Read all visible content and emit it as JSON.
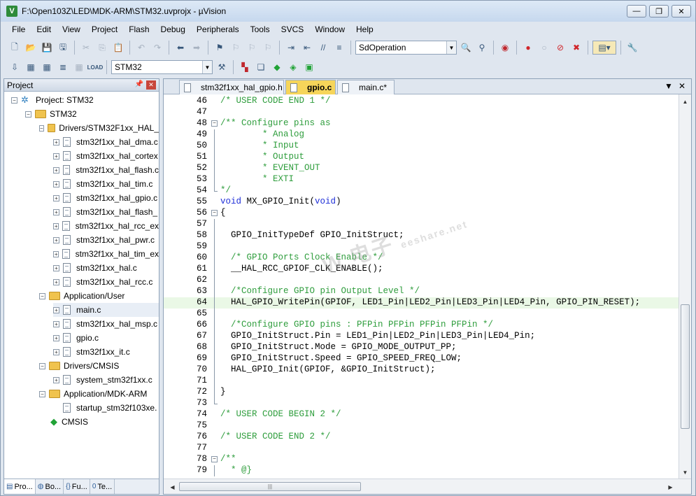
{
  "window": {
    "title": "F:\\Open103Z\\LED\\MDK-ARM\\STM32.uvprojx - µVision",
    "app_icon_label": "V",
    "controls": [
      "—",
      "❐",
      "✕"
    ]
  },
  "menu": [
    "File",
    "Edit",
    "View",
    "Project",
    "Flash",
    "Debug",
    "Peripherals",
    "Tools",
    "SVCS",
    "Window",
    "Help"
  ],
  "toolbar": {
    "find_combo_value": "SdOperation",
    "target_combo_value": "STM32"
  },
  "project_pane": {
    "title": "Project",
    "pin_icon": "pin-icon",
    "root": "Project: STM32",
    "target": "STM32",
    "tree": [
      {
        "label": "Drivers/STM32F1xx_HAL_",
        "kind": "folder",
        "level": 2
      },
      {
        "label": "stm32f1xx_hal_dma.c",
        "kind": "file",
        "level": 3
      },
      {
        "label": "stm32f1xx_hal_cortex",
        "kind": "file",
        "level": 3
      },
      {
        "label": "stm32f1xx_hal_flash.c",
        "kind": "file",
        "level": 3
      },
      {
        "label": "stm32f1xx_hal_tim.c",
        "kind": "file",
        "level": 3
      },
      {
        "label": "stm32f1xx_hal_gpio.c",
        "kind": "file",
        "level": 3
      },
      {
        "label": "stm32f1xx_hal_flash_",
        "kind": "file",
        "level": 3
      },
      {
        "label": "stm32f1xx_hal_rcc_ex",
        "kind": "file",
        "level": 3
      },
      {
        "label": "stm32f1xx_hal_pwr.c",
        "kind": "file",
        "level": 3
      },
      {
        "label": "stm32f1xx_hal_tim_ex",
        "kind": "file",
        "level": 3
      },
      {
        "label": "stm32f1xx_hal.c",
        "kind": "file",
        "level": 3
      },
      {
        "label": "stm32f1xx_hal_rcc.c",
        "kind": "file",
        "level": 3
      },
      {
        "label": "Application/User",
        "kind": "folder",
        "level": 2
      },
      {
        "label": "main.c",
        "kind": "file",
        "level": 3,
        "selected": true
      },
      {
        "label": "stm32f1xx_hal_msp.c",
        "kind": "file",
        "level": 3
      },
      {
        "label": "gpio.c",
        "kind": "file",
        "level": 3
      },
      {
        "label": "stm32f1xx_it.c",
        "kind": "file",
        "level": 3
      },
      {
        "label": "Drivers/CMSIS",
        "kind": "folder",
        "level": 2
      },
      {
        "label": "system_stm32f1xx.c",
        "kind": "file",
        "level": 3
      },
      {
        "label": "Application/MDK-ARM",
        "kind": "folder",
        "level": 2
      },
      {
        "label": "startup_stm32f103xe.",
        "kind": "file-noexp",
        "level": 3
      },
      {
        "label": "CMSIS",
        "kind": "cmsis",
        "level": 2
      }
    ],
    "bottom_tabs": [
      {
        "icon": "▤",
        "label": "Pro..."
      },
      {
        "icon": "◍",
        "label": "Bo..."
      },
      {
        "icon": "{}",
        "label": "Fu..."
      },
      {
        "icon": "0",
        "label": "Te..."
      }
    ]
  },
  "editor": {
    "tabs": [
      {
        "label": "stm32f1xx_hal_gpio.h",
        "active": false
      },
      {
        "label": "gpio.c",
        "active": true
      },
      {
        "label": "main.c*",
        "active": false
      }
    ],
    "tab_menu_glyph": "▼",
    "tab_close_glyph": "✕",
    "lines": [
      {
        "n": "46",
        "fold": "",
        "segs": [
          [
            "c",
            "/* USER CODE END 1 */"
          ]
        ]
      },
      {
        "n": "47",
        "fold": "",
        "segs": []
      },
      {
        "n": "48",
        "fold": "box",
        "segs": [
          [
            "c",
            "/** Configure pins as"
          ]
        ]
      },
      {
        "n": "49",
        "fold": "line",
        "segs": [
          [
            "c",
            "        * Analog"
          ]
        ]
      },
      {
        "n": "50",
        "fold": "line",
        "segs": [
          [
            "c",
            "        * Input"
          ]
        ]
      },
      {
        "n": "51",
        "fold": "line",
        "segs": [
          [
            "c",
            "        * Output"
          ]
        ]
      },
      {
        "n": "52",
        "fold": "line",
        "segs": [
          [
            "c",
            "        * EVENT_OUT"
          ]
        ]
      },
      {
        "n": "53",
        "fold": "line",
        "segs": [
          [
            "c",
            "        * EXTI"
          ]
        ]
      },
      {
        "n": "54",
        "fold": "end",
        "segs": [
          [
            "c",
            "*/"
          ]
        ]
      },
      {
        "n": "55",
        "fold": "",
        "segs": [
          [
            "k",
            "void"
          ],
          [
            "i",
            " MX_GPIO_Init("
          ],
          [
            "k",
            "void"
          ],
          [
            "i",
            ")"
          ]
        ]
      },
      {
        "n": "56",
        "fold": "box",
        "segs": [
          [
            "i",
            "{"
          ]
        ]
      },
      {
        "n": "57",
        "fold": "line",
        "segs": []
      },
      {
        "n": "58",
        "fold": "line",
        "segs": [
          [
            "i",
            "  GPIO_InitTypeDef GPIO_InitStruct;"
          ]
        ]
      },
      {
        "n": "59",
        "fold": "line",
        "segs": []
      },
      {
        "n": "60",
        "fold": "line",
        "segs": [
          [
            "c",
            "  /* GPIO Ports Clock Enable */"
          ]
        ]
      },
      {
        "n": "61",
        "fold": "line",
        "segs": [
          [
            "i",
            "  __HAL_RCC_GPIOF_CLK_ENABLE();"
          ]
        ]
      },
      {
        "n": "62",
        "fold": "line",
        "segs": []
      },
      {
        "n": "63",
        "fold": "line",
        "segs": [
          [
            "c",
            "  /*Configure GPIO pin Output Level */"
          ]
        ]
      },
      {
        "n": "64",
        "fold": "line",
        "hl": true,
        "segs": [
          [
            "i",
            "  HAL_GPIO_WritePin(GPIOF, LED1_Pin|LED2_Pin|LED3_Pin|LED4_Pin, GPIO_PIN_RESET);"
          ]
        ]
      },
      {
        "n": "65",
        "fold": "line",
        "segs": []
      },
      {
        "n": "66",
        "fold": "line",
        "segs": [
          [
            "c",
            "  /*Configure GPIO pins : PFPin PFPin PFPin PFPin */"
          ]
        ]
      },
      {
        "n": "67",
        "fold": "line",
        "segs": [
          [
            "i",
            "  GPIO_InitStruct.Pin = LED1_Pin|LED2_Pin|LED3_Pin|LED4_Pin;"
          ]
        ]
      },
      {
        "n": "68",
        "fold": "line",
        "segs": [
          [
            "i",
            "  GPIO_InitStruct.Mode = GPIO_MODE_OUTPUT_PP;"
          ]
        ]
      },
      {
        "n": "69",
        "fold": "line",
        "segs": [
          [
            "i",
            "  GPIO_InitStruct.Speed = GPIO_SPEED_FREQ_LOW;"
          ]
        ]
      },
      {
        "n": "70",
        "fold": "line",
        "segs": [
          [
            "i",
            "  HAL_GPIO_Init(GPIOF, &GPIO_InitStruct);"
          ]
        ]
      },
      {
        "n": "71",
        "fold": "line",
        "segs": []
      },
      {
        "n": "72",
        "fold": "line",
        "segs": [
          [
            "i",
            "}"
          ]
        ]
      },
      {
        "n": "73",
        "fold": "end",
        "segs": []
      },
      {
        "n": "74",
        "fold": "",
        "segs": [
          [
            "c",
            "/* USER CODE BEGIN 2 */"
          ]
        ]
      },
      {
        "n": "75",
        "fold": "",
        "segs": []
      },
      {
        "n": "76",
        "fold": "",
        "segs": [
          [
            "c",
            "/* USER CODE END 2 */"
          ]
        ]
      },
      {
        "n": "77",
        "fold": "",
        "segs": []
      },
      {
        "n": "78",
        "fold": "box",
        "segs": [
          [
            "c",
            "/**"
          ]
        ]
      },
      {
        "n": "79",
        "fold": "line",
        "segs": [
          [
            "c",
            "  * @}"
          ]
        ]
      }
    ]
  },
  "watermark": {
    "text": "W 电子",
    "small": "eeshare.net"
  },
  "colors": {
    "comment": "#2e9d3c",
    "keyword": "#1f2fd8",
    "highlight": "#eaf8e6",
    "active_tab": "#f6d55a"
  }
}
